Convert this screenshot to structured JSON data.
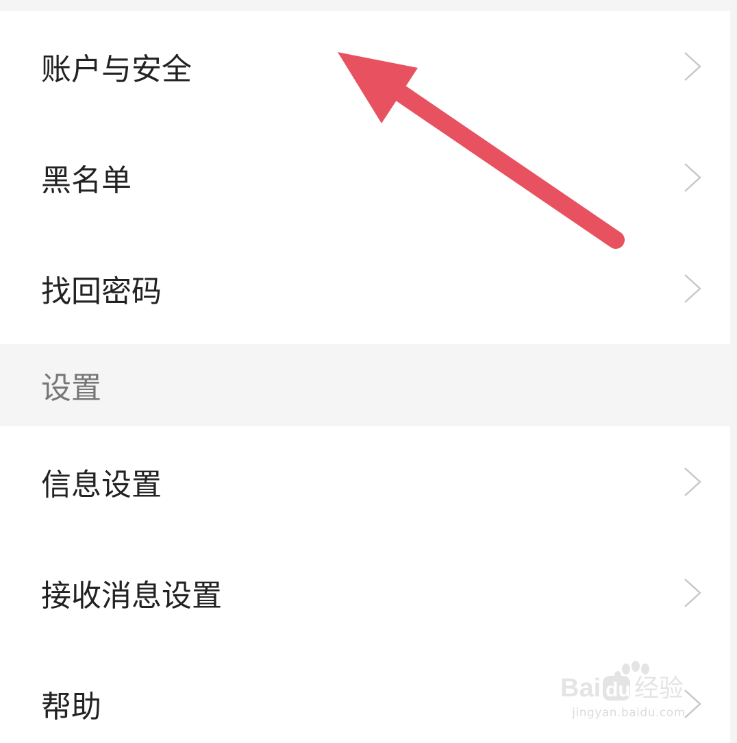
{
  "menu_top": [
    {
      "label": "账户与安全",
      "icon": "chevron-right-icon"
    },
    {
      "label": "黑名单",
      "icon": "chevron-right-icon"
    },
    {
      "label": "找回密码",
      "icon": "chevron-right-icon"
    }
  ],
  "settings_section": {
    "title": "设置"
  },
  "menu_settings": [
    {
      "label": "信息设置",
      "icon": "chevron-right-icon"
    },
    {
      "label": "接收消息设置",
      "icon": "chevron-right-icon"
    },
    {
      "label": "帮助",
      "icon": "chevron-right-icon"
    }
  ],
  "annotation": {
    "type": "arrow",
    "color": "#e8515f",
    "points_to": "账户与安全"
  },
  "watermark": {
    "logo_text": "Baidu经验",
    "url": "jingyan.baidu.com"
  }
}
